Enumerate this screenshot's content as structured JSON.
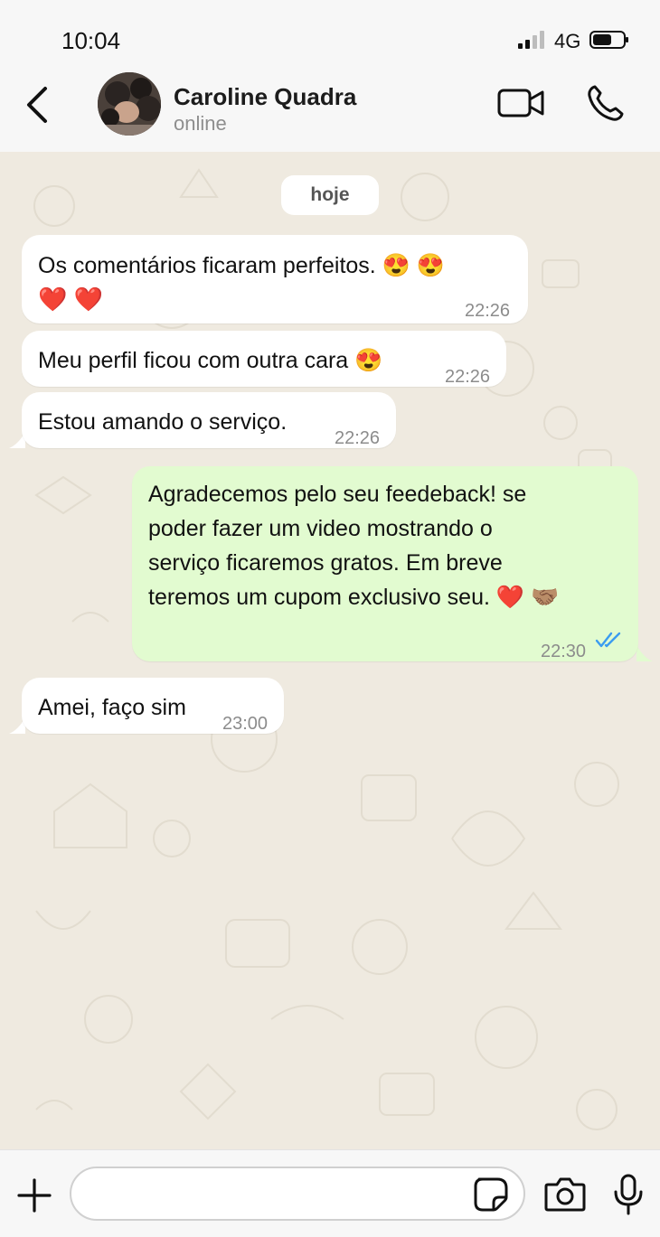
{
  "status_bar": {
    "time": "10:04",
    "network": "4G",
    "signal_icon": "cellular-signal-icon",
    "battery_icon": "battery-icon"
  },
  "header": {
    "back_icon": "chevron-left-icon",
    "contact_name": "Caroline Quadra",
    "contact_status": "online",
    "video_icon": "video-camera-icon",
    "phone_icon": "phone-icon"
  },
  "chat": {
    "date_label": "hoje",
    "messages": [
      {
        "direction": "in",
        "line1": "Os comentários ficaram perfeitos. 😍 😍",
        "line2": "❤️ ❤️",
        "time": "22:26"
      },
      {
        "direction": "in",
        "text": "Meu perfil ficou com outra cara 😍",
        "time": "22:26"
      },
      {
        "direction": "in",
        "text": "Estou amando o serviço.",
        "time": "22:26"
      },
      {
        "direction": "out",
        "lines": [
          "Agradecemos pelo seu feedeback! se",
          "poder fazer um video mostrando o",
          "serviço ficaremos gratos. Em breve",
          "teremos um cupom exclusivo seu. ❤️ 🤝🏽"
        ],
        "time": "22:30",
        "status_icon": "double-check-read-icon"
      },
      {
        "direction": "in",
        "text": "Amei, faço sim",
        "time": "23:00"
      }
    ]
  },
  "composer": {
    "plus_icon": "plus-icon",
    "input_value": "",
    "input_placeholder": "",
    "sticker_icon": "sticker-icon",
    "camera_icon": "camera-icon",
    "mic_icon": "microphone-icon"
  },
  "colors": {
    "outgoing_bubble": "#e2fbd0",
    "incoming_bubble": "#ffffff",
    "read_check": "#3b9cf0",
    "chat_background": "#efeae0"
  }
}
